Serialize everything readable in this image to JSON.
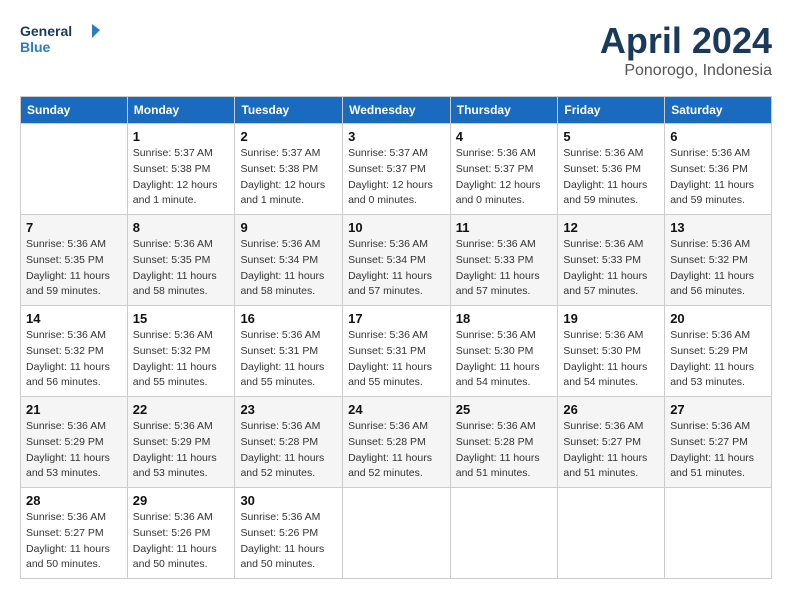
{
  "logo": {
    "line1": "General",
    "line2": "Blue"
  },
  "title": "April 2024",
  "subtitle": "Ponorogo, Indonesia",
  "days_of_week": [
    "Sunday",
    "Monday",
    "Tuesday",
    "Wednesday",
    "Thursday",
    "Friday",
    "Saturday"
  ],
  "weeks": [
    [
      {
        "day": "",
        "info": ""
      },
      {
        "day": "1",
        "info": "Sunrise: 5:37 AM\nSunset: 5:38 PM\nDaylight: 12 hours\nand 1 minute."
      },
      {
        "day": "2",
        "info": "Sunrise: 5:37 AM\nSunset: 5:38 PM\nDaylight: 12 hours\nand 1 minute."
      },
      {
        "day": "3",
        "info": "Sunrise: 5:37 AM\nSunset: 5:37 PM\nDaylight: 12 hours\nand 0 minutes."
      },
      {
        "day": "4",
        "info": "Sunrise: 5:36 AM\nSunset: 5:37 PM\nDaylight: 12 hours\nand 0 minutes."
      },
      {
        "day": "5",
        "info": "Sunrise: 5:36 AM\nSunset: 5:36 PM\nDaylight: 11 hours\nand 59 minutes."
      },
      {
        "day": "6",
        "info": "Sunrise: 5:36 AM\nSunset: 5:36 PM\nDaylight: 11 hours\nand 59 minutes."
      }
    ],
    [
      {
        "day": "7",
        "info": "Sunrise: 5:36 AM\nSunset: 5:35 PM\nDaylight: 11 hours\nand 59 minutes."
      },
      {
        "day": "8",
        "info": "Sunrise: 5:36 AM\nSunset: 5:35 PM\nDaylight: 11 hours\nand 58 minutes."
      },
      {
        "day": "9",
        "info": "Sunrise: 5:36 AM\nSunset: 5:34 PM\nDaylight: 11 hours\nand 58 minutes."
      },
      {
        "day": "10",
        "info": "Sunrise: 5:36 AM\nSunset: 5:34 PM\nDaylight: 11 hours\nand 57 minutes."
      },
      {
        "day": "11",
        "info": "Sunrise: 5:36 AM\nSunset: 5:33 PM\nDaylight: 11 hours\nand 57 minutes."
      },
      {
        "day": "12",
        "info": "Sunrise: 5:36 AM\nSunset: 5:33 PM\nDaylight: 11 hours\nand 57 minutes."
      },
      {
        "day": "13",
        "info": "Sunrise: 5:36 AM\nSunset: 5:32 PM\nDaylight: 11 hours\nand 56 minutes."
      }
    ],
    [
      {
        "day": "14",
        "info": "Sunrise: 5:36 AM\nSunset: 5:32 PM\nDaylight: 11 hours\nand 56 minutes."
      },
      {
        "day": "15",
        "info": "Sunrise: 5:36 AM\nSunset: 5:32 PM\nDaylight: 11 hours\nand 55 minutes."
      },
      {
        "day": "16",
        "info": "Sunrise: 5:36 AM\nSunset: 5:31 PM\nDaylight: 11 hours\nand 55 minutes."
      },
      {
        "day": "17",
        "info": "Sunrise: 5:36 AM\nSunset: 5:31 PM\nDaylight: 11 hours\nand 55 minutes."
      },
      {
        "day": "18",
        "info": "Sunrise: 5:36 AM\nSunset: 5:30 PM\nDaylight: 11 hours\nand 54 minutes."
      },
      {
        "day": "19",
        "info": "Sunrise: 5:36 AM\nSunset: 5:30 PM\nDaylight: 11 hours\nand 54 minutes."
      },
      {
        "day": "20",
        "info": "Sunrise: 5:36 AM\nSunset: 5:29 PM\nDaylight: 11 hours\nand 53 minutes."
      }
    ],
    [
      {
        "day": "21",
        "info": "Sunrise: 5:36 AM\nSunset: 5:29 PM\nDaylight: 11 hours\nand 53 minutes."
      },
      {
        "day": "22",
        "info": "Sunrise: 5:36 AM\nSunset: 5:29 PM\nDaylight: 11 hours\nand 53 minutes."
      },
      {
        "day": "23",
        "info": "Sunrise: 5:36 AM\nSunset: 5:28 PM\nDaylight: 11 hours\nand 52 minutes."
      },
      {
        "day": "24",
        "info": "Sunrise: 5:36 AM\nSunset: 5:28 PM\nDaylight: 11 hours\nand 52 minutes."
      },
      {
        "day": "25",
        "info": "Sunrise: 5:36 AM\nSunset: 5:28 PM\nDaylight: 11 hours\nand 51 minutes."
      },
      {
        "day": "26",
        "info": "Sunrise: 5:36 AM\nSunset: 5:27 PM\nDaylight: 11 hours\nand 51 minutes."
      },
      {
        "day": "27",
        "info": "Sunrise: 5:36 AM\nSunset: 5:27 PM\nDaylight: 11 hours\nand 51 minutes."
      }
    ],
    [
      {
        "day": "28",
        "info": "Sunrise: 5:36 AM\nSunset: 5:27 PM\nDaylight: 11 hours\nand 50 minutes."
      },
      {
        "day": "29",
        "info": "Sunrise: 5:36 AM\nSunset: 5:26 PM\nDaylight: 11 hours\nand 50 minutes."
      },
      {
        "day": "30",
        "info": "Sunrise: 5:36 AM\nSunset: 5:26 PM\nDaylight: 11 hours\nand 50 minutes."
      },
      {
        "day": "",
        "info": ""
      },
      {
        "day": "",
        "info": ""
      },
      {
        "day": "",
        "info": ""
      },
      {
        "day": "",
        "info": ""
      }
    ]
  ]
}
